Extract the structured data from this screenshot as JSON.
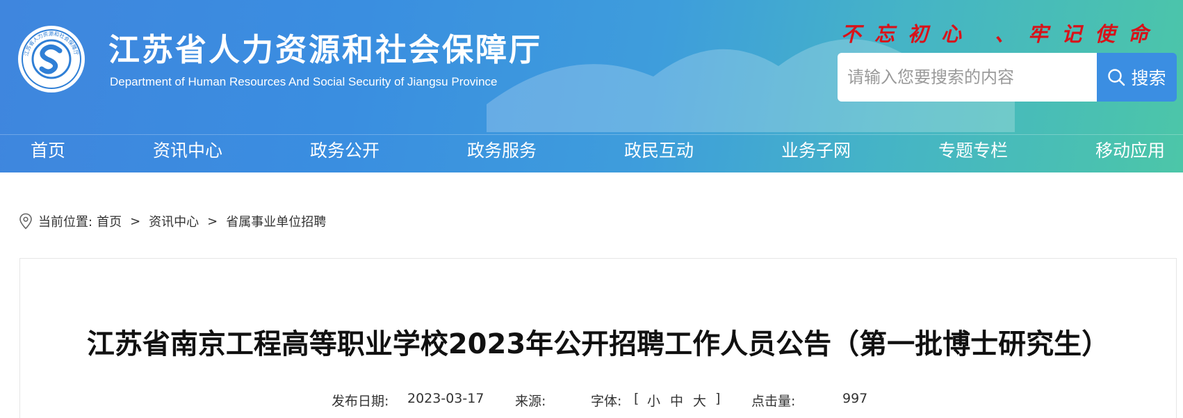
{
  "header": {
    "logo_text": "江苏省人力资源和社会保障厅",
    "site_title": "江苏省人力资源和社会保障厅",
    "site_subtitle": "Department of Human Resources And Social Security of Jiangsu Province",
    "slogan": "不忘初心 、牢记使命",
    "search": {
      "placeholder": "请输入您要搜索的内容",
      "button_label": "搜索"
    },
    "colors": {
      "slogan": "#d8121a",
      "search_button": "#3b8ee2"
    }
  },
  "nav": {
    "items": [
      {
        "label": "首页"
      },
      {
        "label": "资讯中心"
      },
      {
        "label": "政务公开"
      },
      {
        "label": "政务服务"
      },
      {
        "label": "政民互动"
      },
      {
        "label": "业务子网"
      },
      {
        "label": "专题专栏"
      },
      {
        "label": "移动应用"
      }
    ]
  },
  "breadcrumb": {
    "prefix": "当前位置:",
    "items": [
      {
        "label": "首页"
      },
      {
        "label": "资讯中心"
      },
      {
        "label": "省属事业单位招聘"
      }
    ],
    "separator": ">"
  },
  "article": {
    "title": "江苏省南京工程高等职业学校2023年公开招聘工作人员公告（第一批博士研究生）",
    "meta": {
      "date_label": "发布日期:",
      "date_value": "2023-03-17",
      "source_label": "来源:",
      "source_value": "",
      "font_label": "字体:",
      "bracket_open": "[",
      "font_small": "小",
      "font_medium": "中",
      "font_large": "大",
      "bracket_close": "]",
      "clicks_label": "点击量:",
      "clicks_value": "997"
    }
  }
}
